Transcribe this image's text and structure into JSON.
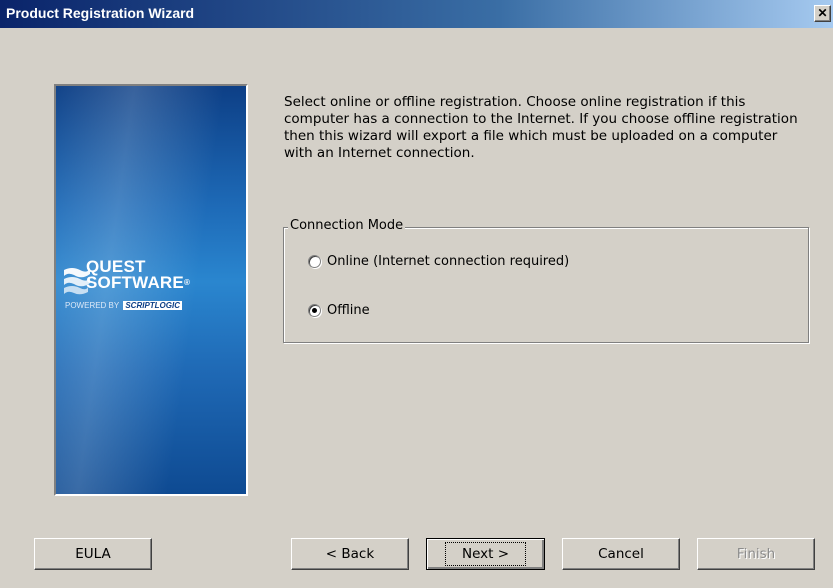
{
  "window": {
    "title": "Product Registration Wizard",
    "close_glyph": "✕"
  },
  "banner": {
    "logo_line1": "QUEST",
    "logo_line2": "SOFTWARE",
    "trademark": "®",
    "powered_by": "POWERED BY",
    "powered_brand": "SCRIPTLOGIC"
  },
  "intro_text": "Select online or offline registration. Choose online registration if this computer has a connection to the Internet. If you choose offline registration then this wizard will export a file which must be uploaded on a computer with an Internet connection.",
  "connection_mode": {
    "legend": "Connection Mode",
    "options": [
      {
        "label": "Online (Internet connection required)",
        "checked": false
      },
      {
        "label": "Offline",
        "checked": true
      }
    ]
  },
  "buttons": {
    "eula": "EULA",
    "back": "< Back",
    "next": "Next >",
    "cancel": "Cancel",
    "finish": "Finish"
  },
  "colors": {
    "titlebar_start": "#0a246a",
    "titlebar_end": "#a6caf0",
    "dialog_bg": "#d4d0c8",
    "banner_blue": "#1e6bb8"
  }
}
